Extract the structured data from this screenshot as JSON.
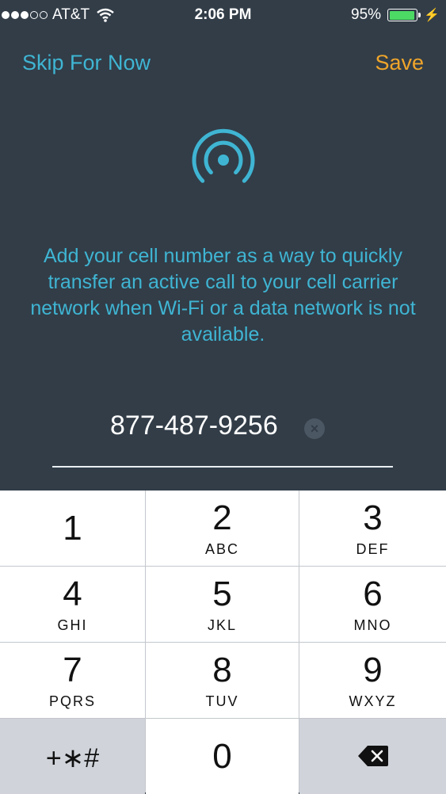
{
  "status_bar": {
    "carrier": "AT&T",
    "time": "2:06 PM",
    "battery": "95%",
    "battery_level": 0.95
  },
  "nav": {
    "skip_label": "Skip For Now",
    "save_label": "Save"
  },
  "colors": {
    "accent": "#3fb5d3",
    "save": "#f0a52a",
    "background": "#323d48"
  },
  "message": "Add your cell number as a way to quickly transfer an active call to your cell carrier network when Wi-Fi or a data network is not available.",
  "phone_input": {
    "value": "877-487-9256"
  },
  "keypad": {
    "keys": [
      {
        "digit": "1",
        "letters": ""
      },
      {
        "digit": "2",
        "letters": "ABC"
      },
      {
        "digit": "3",
        "letters": "DEF"
      },
      {
        "digit": "4",
        "letters": "GHI"
      },
      {
        "digit": "5",
        "letters": "JKL"
      },
      {
        "digit": "6",
        "letters": "MNO"
      },
      {
        "digit": "7",
        "letters": "PQRS"
      },
      {
        "digit": "8",
        "letters": "TUV"
      },
      {
        "digit": "9",
        "letters": "WXYZ"
      }
    ],
    "symbols": "+∗#",
    "zero": "0"
  }
}
